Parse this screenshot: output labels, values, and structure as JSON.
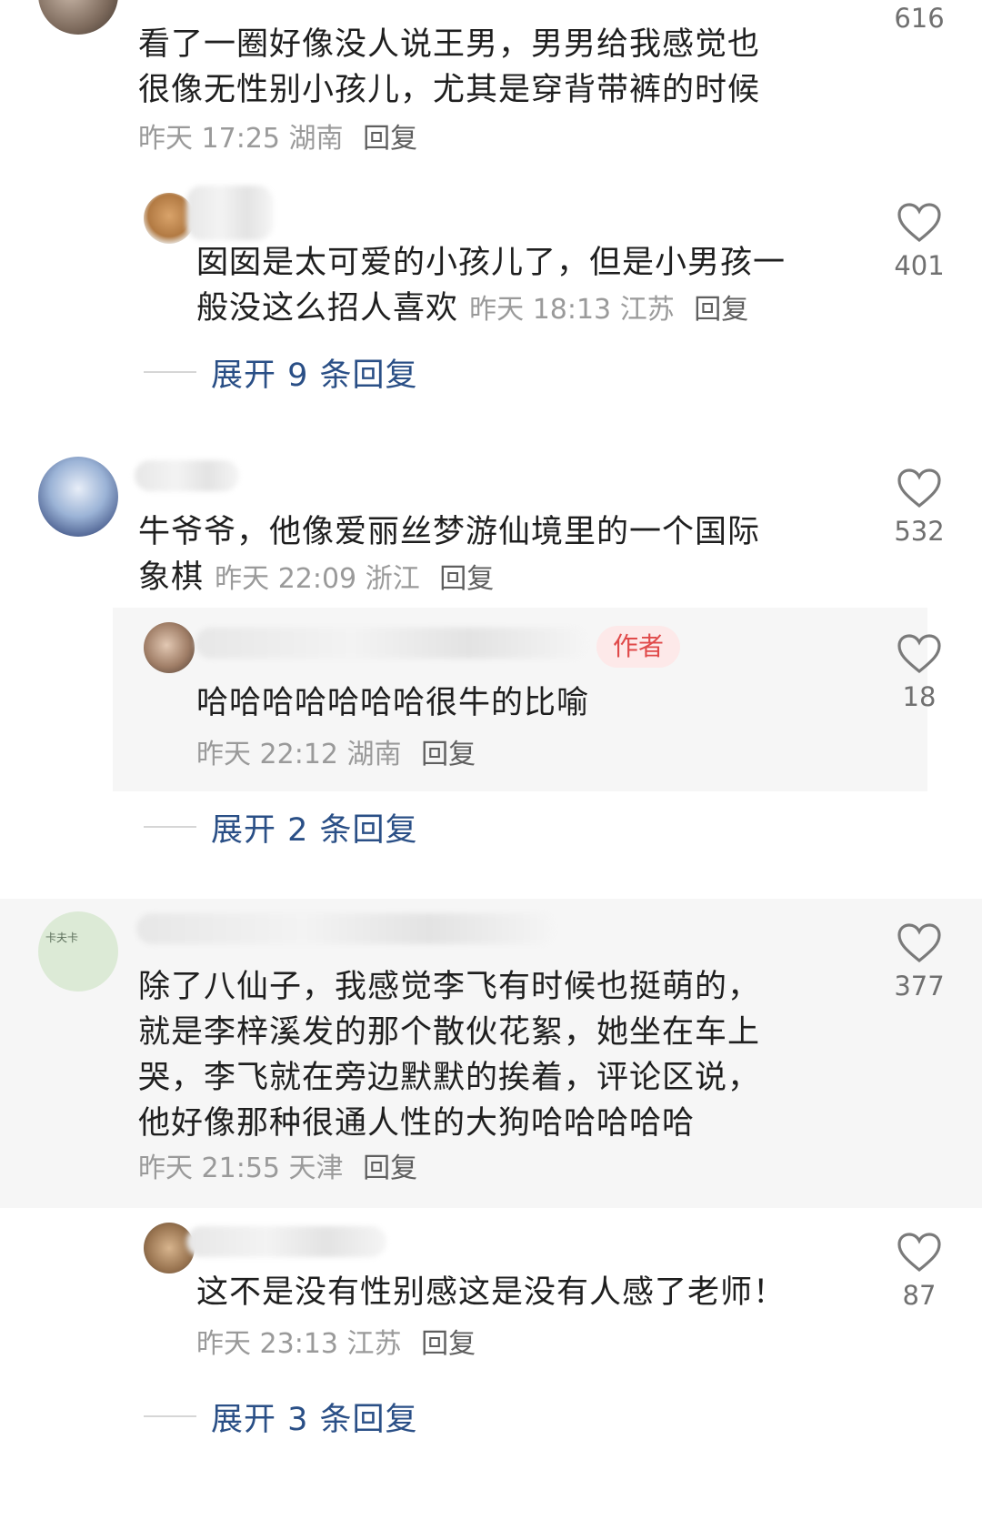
{
  "comments": [
    {
      "text_lines": [
        "看了一圈好像没人说王男，男男给我感觉也",
        "很像无性别小孩儿，尤其是穿背带裤的时候"
      ],
      "time": "昨天 17:25",
      "location": "湖南",
      "reply_label": "回复",
      "likes": "616"
    },
    {
      "text_lines": [
        "囡囡是太可爱的小孩儿了，但是小男孩一",
        "般没这么招人喜欢"
      ],
      "time": "昨天 18:13",
      "location": "江苏",
      "reply_label": "回复",
      "likes": "401"
    },
    {
      "expand_label": "展开 9 条回复"
    },
    {
      "text_lines": [
        "牛爷爷，他像爱丽丝梦游仙境里的一个国际",
        "象棋"
      ],
      "time": "昨天 22:09",
      "location": "浙江",
      "reply_label": "回复",
      "likes": "532"
    },
    {
      "author_tag": "作者",
      "text_lines": [
        "哈哈哈哈哈哈哈很牛的比喻"
      ],
      "time": "昨天 22:12",
      "location": "湖南",
      "reply_label": "回复",
      "likes": "18"
    },
    {
      "expand_label": "展开 2 条回复"
    },
    {
      "text_lines": [
        "除了八仙子，我感觉李飞有时候也挺萌的，",
        "就是李梓溪发的那个散伙花絮，她坐在车上",
        "哭，李飞就在旁边默默的挨着，评论区说，",
        "他好像那种很通人性的大狗哈哈哈哈哈"
      ],
      "time": "昨天 21:55",
      "location": "天津",
      "reply_label": "回复",
      "likes": "377",
      "avatar_text": "卡夫卡"
    },
    {
      "text_lines": [
        "这不是没有性别感这是没有人感了老师！"
      ],
      "time": "昨天 23:13",
      "location": "江苏",
      "reply_label": "回复",
      "likes": "87"
    },
    {
      "expand_label": "展开 3 条回复"
    }
  ],
  "colors": {
    "text": "#1f1f1f",
    "meta": "#9a9a9a",
    "link": "#2a4f86",
    "author_tag": "#e04a4a",
    "highlight_bg": "#f6f6f6"
  },
  "icons": {
    "like": "heart-outline-icon"
  }
}
